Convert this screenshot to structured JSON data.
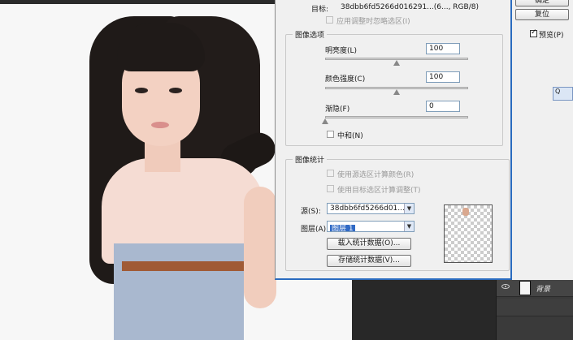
{
  "dialog": {
    "target_label": "目标:",
    "target_value": "38dbb6fd5266d016291...(6..., RGB/8)",
    "ignore_selection_label": "应用调整时忽略选区(I)",
    "image_options": {
      "title": "图像选项",
      "luminance_label": "明亮度(L)",
      "luminance_value": "100",
      "luminance_level": 100,
      "color_intensity_label": "颜色强度(C)",
      "color_intensity_value": "100",
      "color_intensity_level": 100,
      "fade_label": "渐隐(F)",
      "fade_value": "0",
      "fade_level": 0,
      "neutralize_label": "中和(N)"
    },
    "image_statistics": {
      "title": "图像统计",
      "use_source_selection_label": "使用源选区计算颜色(R)",
      "use_target_selection_label": "使用目标选区计算调整(T)",
      "source_label": "源(S):",
      "source_value": "38dbb6fd5266d01...",
      "layer_label": "图层(A):",
      "layer_value": "图层 1",
      "load_stats_button": "载入统计数据(O)...",
      "save_stats_button": "存储统计数据(V)..."
    }
  },
  "side": {
    "ok_button": "确定",
    "reset_button": "复位",
    "preview_label": "预览(P)",
    "preview_checked": true,
    "tool_label": "Q"
  },
  "layers_panel": {
    "layer_name": "背景"
  }
}
